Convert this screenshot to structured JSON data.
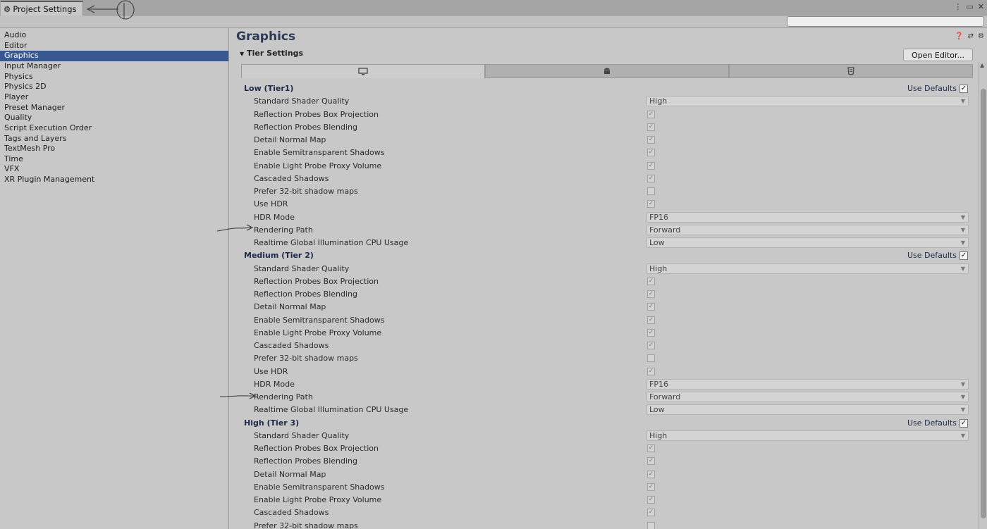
{
  "window": {
    "tab_title": "Project Settings",
    "window_icons": [
      "⋮",
      "▭",
      "✕"
    ]
  },
  "search": {
    "placeholder": "",
    "value": ""
  },
  "sidebar": {
    "items": [
      {
        "label": "Audio",
        "active": false
      },
      {
        "label": "Editor",
        "active": false
      },
      {
        "label": "Graphics",
        "active": true
      },
      {
        "label": "Input Manager",
        "active": false
      },
      {
        "label": "Physics",
        "active": false
      },
      {
        "label": "Physics 2D",
        "active": false
      },
      {
        "label": "Player",
        "active": false
      },
      {
        "label": "Preset Manager",
        "active": false
      },
      {
        "label": "Quality",
        "active": false
      },
      {
        "label": "Script Execution Order",
        "active": false
      },
      {
        "label": "Tags and Layers",
        "active": false
      },
      {
        "label": "TextMesh Pro",
        "active": false
      },
      {
        "label": "Time",
        "active": false
      },
      {
        "label": "VFX",
        "active": false
      },
      {
        "label": "XR Plugin Management",
        "active": false
      }
    ]
  },
  "main": {
    "title": "Graphics",
    "section_title": "Tier Settings",
    "open_editor_label": "Open Editor...",
    "platform_tabs": [
      {
        "icon": "monitor-icon",
        "active": true
      },
      {
        "icon": "android-icon",
        "active": false
      },
      {
        "icon": "html5-icon",
        "active": false
      }
    ],
    "use_defaults_label": "Use Defaults",
    "tiers": [
      {
        "name": "Low (Tier1)",
        "use_defaults": true,
        "settings": [
          {
            "label": "Standard Shader Quality",
            "type": "dropdown",
            "value": "High"
          },
          {
            "label": "Reflection Probes Box Projection",
            "type": "checkbox",
            "value": true
          },
          {
            "label": "Reflection Probes Blending",
            "type": "checkbox",
            "value": true
          },
          {
            "label": "Detail Normal Map",
            "type": "checkbox",
            "value": true
          },
          {
            "label": "Enable Semitransparent Shadows",
            "type": "checkbox",
            "value": true
          },
          {
            "label": "Enable Light Probe Proxy Volume",
            "type": "checkbox",
            "value": true
          },
          {
            "label": "Cascaded Shadows",
            "type": "checkbox",
            "value": true
          },
          {
            "label": "Prefer 32-bit shadow maps",
            "type": "checkbox",
            "value": false
          },
          {
            "label": "Use HDR",
            "type": "checkbox",
            "value": true
          },
          {
            "label": "HDR Mode",
            "type": "dropdown",
            "value": "FP16"
          },
          {
            "label": "Rendering Path",
            "type": "dropdown",
            "value": "Forward"
          },
          {
            "label": "Realtime Global Illumination CPU Usage",
            "type": "dropdown",
            "value": "Low"
          }
        ]
      },
      {
        "name": "Medium (Tier 2)",
        "use_defaults": true,
        "settings": [
          {
            "label": "Standard Shader Quality",
            "type": "dropdown",
            "value": "High"
          },
          {
            "label": "Reflection Probes Box Projection",
            "type": "checkbox",
            "value": true
          },
          {
            "label": "Reflection Probes Blending",
            "type": "checkbox",
            "value": true
          },
          {
            "label": "Detail Normal Map",
            "type": "checkbox",
            "value": true
          },
          {
            "label": "Enable Semitransparent Shadows",
            "type": "checkbox",
            "value": true
          },
          {
            "label": "Enable Light Probe Proxy Volume",
            "type": "checkbox",
            "value": true
          },
          {
            "label": "Cascaded Shadows",
            "type": "checkbox",
            "value": true
          },
          {
            "label": "Prefer 32-bit shadow maps",
            "type": "checkbox",
            "value": false
          },
          {
            "label": "Use HDR",
            "type": "checkbox",
            "value": true
          },
          {
            "label": "HDR Mode",
            "type": "dropdown",
            "value": "FP16"
          },
          {
            "label": "Rendering Path",
            "type": "dropdown",
            "value": "Forward"
          },
          {
            "label": "Realtime Global Illumination CPU Usage",
            "type": "dropdown",
            "value": "Low"
          }
        ]
      },
      {
        "name": "High (Tier 3)",
        "use_defaults": true,
        "settings": [
          {
            "label": "Standard Shader Quality",
            "type": "dropdown",
            "value": "High"
          },
          {
            "label": "Reflection Probes Box Projection",
            "type": "checkbox",
            "value": true
          },
          {
            "label": "Reflection Probes Blending",
            "type": "checkbox",
            "value": true
          },
          {
            "label": "Detail Normal Map",
            "type": "checkbox",
            "value": true
          },
          {
            "label": "Enable Semitransparent Shadows",
            "type": "checkbox",
            "value": true
          },
          {
            "label": "Enable Light Probe Proxy Volume",
            "type": "checkbox",
            "value": true
          },
          {
            "label": "Cascaded Shadows",
            "type": "checkbox",
            "value": true
          },
          {
            "label": "Prefer 32-bit shadow maps",
            "type": "checkbox",
            "value": false
          }
        ]
      }
    ]
  }
}
